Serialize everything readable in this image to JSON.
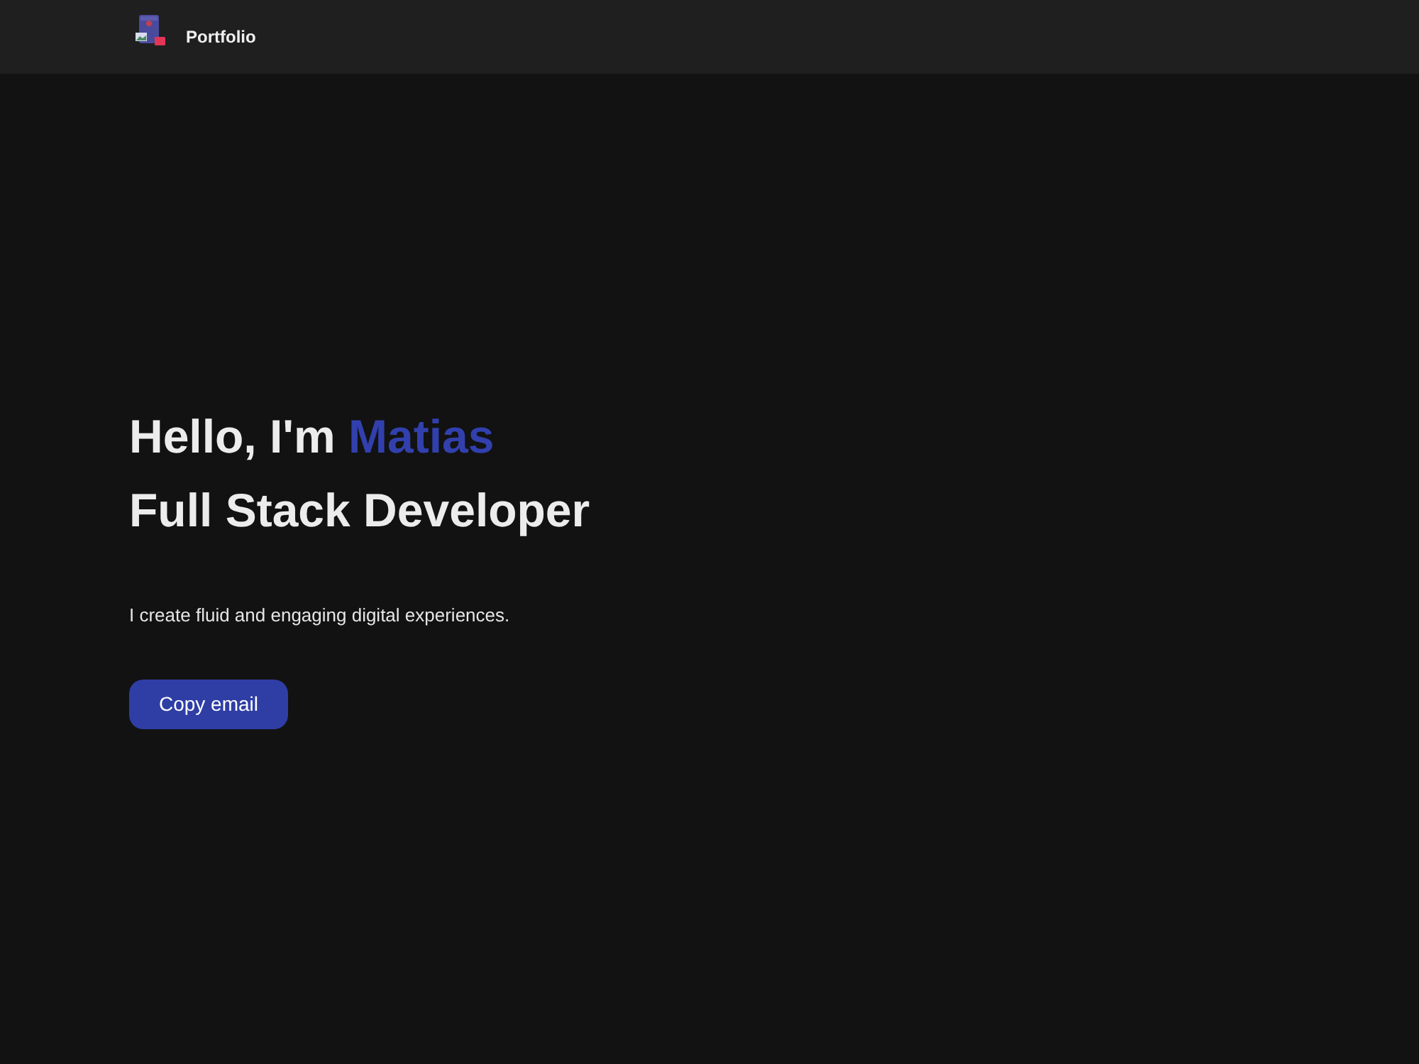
{
  "navbar": {
    "brand": "Portfolio"
  },
  "hero": {
    "greeting": "Hello, I'm",
    "name": "Matias",
    "role": "Full Stack Developer",
    "tagline": "I create fluid and engaging digital experiences.",
    "button": "Copy email"
  }
}
